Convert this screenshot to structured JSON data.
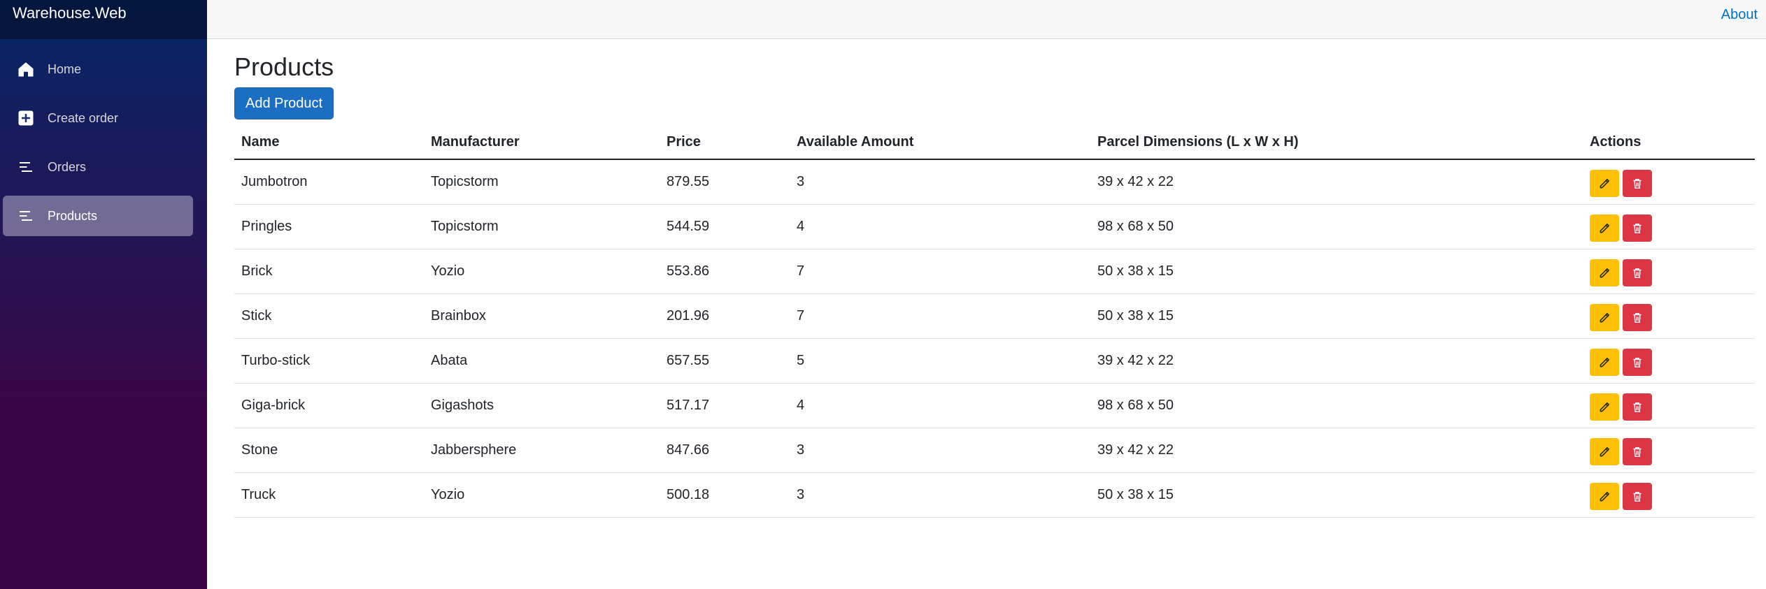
{
  "app": {
    "brand": "Warehouse.Web"
  },
  "sidebar": {
    "items": [
      {
        "label": "Home",
        "icon": "home-icon",
        "active": false
      },
      {
        "label": "Create order",
        "icon": "plus-square-icon",
        "active": false
      },
      {
        "label": "Orders",
        "icon": "list-icon",
        "active": false
      },
      {
        "label": "Products",
        "icon": "list-icon",
        "active": true
      }
    ]
  },
  "topbar": {
    "about_label": "About"
  },
  "page": {
    "title": "Products",
    "add_button_label": "Add Product"
  },
  "table": {
    "headers": [
      "Name",
      "Manufacturer",
      "Price",
      "Available Amount",
      "Parcel Dimensions (L x W x H)",
      "Actions"
    ],
    "rows": [
      {
        "name": "Jumbotron",
        "manufacturer": "Topicstorm",
        "price": "879.55",
        "amount": "3",
        "dimensions": "39 x 42 x 22"
      },
      {
        "name": "Pringles",
        "manufacturer": "Topicstorm",
        "price": "544.59",
        "amount": "4",
        "dimensions": "98 x 68 x 50"
      },
      {
        "name": "Brick",
        "manufacturer": "Yozio",
        "price": "553.86",
        "amount": "7",
        "dimensions": "50 x 38 x 15"
      },
      {
        "name": "Stick",
        "manufacturer": "Brainbox",
        "price": "201.96",
        "amount": "7",
        "dimensions": "50 x 38 x 15"
      },
      {
        "name": "Turbo-stick",
        "manufacturer": "Abata",
        "price": "657.55",
        "amount": "5",
        "dimensions": "39 x 42 x 22"
      },
      {
        "name": "Giga-brick",
        "manufacturer": "Gigashots",
        "price": "517.17",
        "amount": "4",
        "dimensions": "98 x 68 x 50"
      },
      {
        "name": "Stone",
        "manufacturer": "Jabbersphere",
        "price": "847.66",
        "amount": "3",
        "dimensions": "39 x 42 x 22"
      },
      {
        "name": "Truck",
        "manufacturer": "Yozio",
        "price": "500.18",
        "amount": "3",
        "dimensions": "50 x 38 x 15"
      }
    ],
    "row_actions": [
      {
        "icon": "pencil-icon",
        "kind": "edit"
      },
      {
        "icon": "trash-icon",
        "kind": "delete"
      }
    ]
  },
  "colors": {
    "sidebar_top": "#052767",
    "sidebar_bottom": "#3a0647",
    "primary": "#1b6ec2",
    "edit": "#ffc107",
    "delete": "#dc3545",
    "link": "#0071c1"
  }
}
